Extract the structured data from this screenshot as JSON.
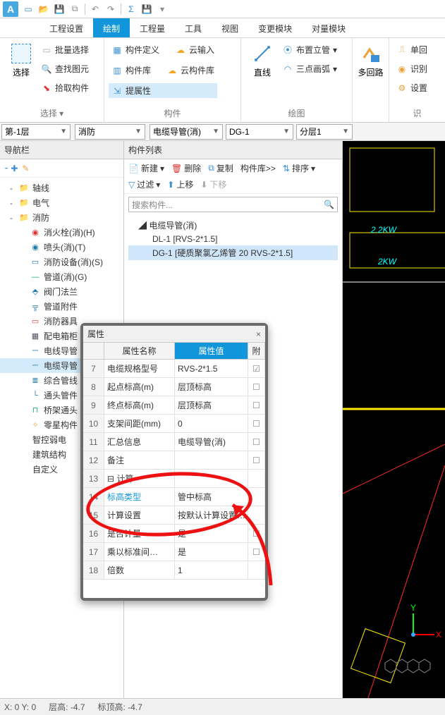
{
  "qat": {
    "app": "A"
  },
  "tabs": [
    "工程设置",
    "绘制",
    "工程量",
    "工具",
    "视图",
    "变更模块",
    "对量模块"
  ],
  "active_tab": 1,
  "ribbon": {
    "g_select": {
      "title": "选择",
      "big": "选择",
      "batch": "批量选择",
      "find": "查找图元",
      "pick": "拾取构件"
    },
    "g_comp": {
      "title": "构件",
      "define": "构件定义",
      "cloudin": "云输入",
      "lib": "构件库",
      "cloudlib": "云构件库",
      "extract": "提属性"
    },
    "g_draw": {
      "title": "绘图",
      "line": "直线",
      "vpipe": "布置立管",
      "arc3": "三点画弧"
    },
    "g_multi": {
      "title": "",
      "big": "多回路"
    },
    "g_rec": {
      "title": "识",
      "a": "单回",
      "b": "识别",
      "c": "设置"
    }
  },
  "combos": {
    "floor": "第-1层",
    "cat": "消防",
    "type": "电缆导管(消)",
    "item": "DG-1",
    "layer": "分层1"
  },
  "nav": {
    "title": "导航栏",
    "tree": [
      {
        "lvl": 0,
        "exp": "-",
        "ic": "📁",
        "label": "轴线",
        "sel": false,
        "col": "#e39b2e"
      },
      {
        "lvl": 0,
        "exp": "-",
        "ic": "📁",
        "label": "电气",
        "sel": false,
        "col": "#e39b2e"
      },
      {
        "lvl": 0,
        "exp": "-",
        "ic": "📁",
        "label": "消防",
        "sel": false,
        "col": "#e39b2e"
      },
      {
        "lvl": 1,
        "exp": "",
        "ic": "◉",
        "label": "消火栓(消)(H)",
        "sel": false,
        "col": "#d33"
      },
      {
        "lvl": 1,
        "exp": "",
        "ic": "◉",
        "label": "喷头(消)(T)",
        "sel": false,
        "col": "#27a"
      },
      {
        "lvl": 1,
        "exp": "",
        "ic": "▭",
        "label": "消防设备(消)(S)",
        "sel": false,
        "col": "#27a"
      },
      {
        "lvl": 1,
        "exp": "",
        "ic": "—",
        "label": "管道(消)(G)",
        "sel": false,
        "col": "#2a8"
      },
      {
        "lvl": 1,
        "exp": "",
        "ic": "⬘",
        "label": "阀门法兰",
        "sel": false,
        "col": "#27a"
      },
      {
        "lvl": 1,
        "exp": "",
        "ic": "╦",
        "label": "管道附件",
        "sel": false,
        "col": "#27a"
      },
      {
        "lvl": 1,
        "exp": "",
        "ic": "▭",
        "label": "消防器具",
        "sel": false,
        "col": "#d33"
      },
      {
        "lvl": 1,
        "exp": "",
        "ic": "▦",
        "label": "配电箱柜",
        "sel": false,
        "col": "#556"
      },
      {
        "lvl": 1,
        "exp": "",
        "ic": "⎓",
        "label": "电线导管",
        "sel": false,
        "col": "#27a"
      },
      {
        "lvl": 1,
        "exp": "",
        "ic": "⎓",
        "label": "电缆导管",
        "sel": true,
        "col": "#27a"
      },
      {
        "lvl": 1,
        "exp": "",
        "ic": "≣",
        "label": "综合管线",
        "sel": false,
        "col": "#27a"
      },
      {
        "lvl": 1,
        "exp": "",
        "ic": "└",
        "label": "通头管件",
        "sel": false,
        "col": "#27a"
      },
      {
        "lvl": 1,
        "exp": "",
        "ic": "⊓",
        "label": "桥架通头",
        "sel": false,
        "col": "#2a8"
      },
      {
        "lvl": 1,
        "exp": "",
        "ic": "✧",
        "label": "零星构件",
        "sel": false,
        "col": "#e8a33c"
      },
      {
        "lvl": 0,
        "exp": "",
        "ic": "",
        "label": "智控弱电",
        "sel": false,
        "col": "#333"
      },
      {
        "lvl": 0,
        "exp": "",
        "ic": "",
        "label": "建筑结构",
        "sel": false,
        "col": "#333"
      },
      {
        "lvl": 0,
        "exp": "",
        "ic": "",
        "label": "自定义",
        "sel": false,
        "col": "#333"
      }
    ]
  },
  "list": {
    "title": "构件列表",
    "tb": {
      "new": "新建",
      "del": "删除",
      "copy": "复制",
      "liblink": "构件库>>",
      "sort": "排序",
      "filter": "过滤",
      "up": "上移",
      "down": "下移"
    },
    "search_ph": "搜索构件...",
    "root": "电缆导管(消)",
    "items": [
      {
        "label": "DL-1 [RVS-2*1.5]",
        "sel": false
      },
      {
        "label": "DG-1 [硬质聚氯乙烯管 20 RVS-2*1.5]",
        "sel": true
      }
    ]
  },
  "prop": {
    "title": "属性",
    "hdrs": {
      "name": "属性名称",
      "value": "属性值",
      "ext": "附"
    },
    "rows": [
      {
        "n": "7",
        "name": "电缆规格型号",
        "val": "RVS-2*1.5",
        "ext": "☑"
      },
      {
        "n": "8",
        "name": "起点标高(m)",
        "val": "层顶标高",
        "ext": "☐"
      },
      {
        "n": "9",
        "name": "终点标高(m)",
        "val": "层顶标高",
        "ext": "☐"
      },
      {
        "n": "10",
        "name": "支架间距(mm)",
        "val": "0",
        "ext": "☐"
      },
      {
        "n": "11",
        "name": "汇总信息",
        "val": "电缆导管(消)",
        "ext": "☐"
      },
      {
        "n": "12",
        "name": "备注",
        "val": "",
        "ext": "☐"
      },
      {
        "n": "13",
        "name": "计算",
        "val": "",
        "ext": "",
        "group": true
      },
      {
        "n": "14",
        "name": "标高类型",
        "val": "管中标高",
        "ext": "",
        "hl": true
      },
      {
        "n": "15",
        "name": "计算设置",
        "val": "按默认计算设置…",
        "ext": ""
      },
      {
        "n": "16",
        "name": "是否计量",
        "val": "是",
        "ext": "☐"
      },
      {
        "n": "17",
        "name": "乘以标准间…",
        "val": "是",
        "ext": "☐"
      },
      {
        "n": "18",
        "name": "倍数",
        "val": "1",
        "ext": ""
      }
    ]
  },
  "canvas": {
    "label1": "2.2KW",
    "label2": "2KW",
    "axisY": "Y",
    "axisX": "X"
  },
  "status": {
    "coord": "X: 0  Y: 0",
    "h1": "层高: -4.7",
    "h2": "标顶高: -4.7"
  }
}
